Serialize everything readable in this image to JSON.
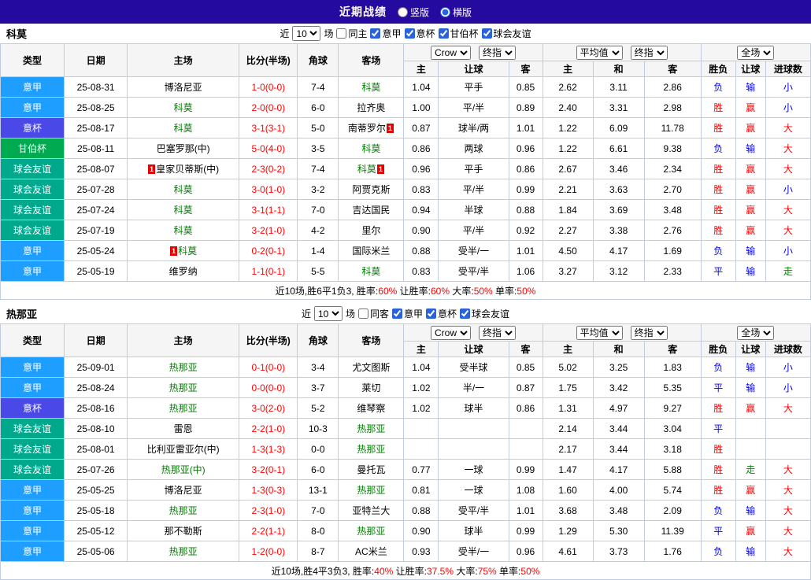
{
  "topbar": {
    "title": "近期战绩",
    "options": [
      {
        "label": "竖版",
        "checked": false
      },
      {
        "label": "横版",
        "checked": true
      }
    ]
  },
  "filter_labels": {
    "near": "近",
    "matches": "场"
  },
  "table_header": {
    "main_cols": [
      "类型",
      "日期",
      "主场",
      "比分(半场)",
      "角球",
      "客场"
    ],
    "odds_selects": [
      "Crow",
      "终指"
    ],
    "avg_selects": [
      "平均值",
      "终指"
    ],
    "scope_select": "全场",
    "sub_cols": [
      "主",
      "让球",
      "客",
      "主",
      "和",
      "客",
      "胜负",
      "让球",
      "进球数"
    ]
  },
  "colors": {
    "league": {
      "意甲": "#1e9fff",
      "意杯": "#4a49e8",
      "甘伯杯": "#00aa50",
      "球会友谊": "#00a88c"
    },
    "result": {
      "胜": "#ff0000",
      "平": "#0000ee",
      "负": "#0000ee",
      "赢": "#ff0000",
      "输": "#0000ee",
      "走": "#008800",
      "大": "#ff0000",
      "小": "#0000ee"
    },
    "score": "#ff0000",
    "team_highlight": "#008000",
    "badge": "#e60000"
  },
  "sections": [
    {
      "team": "科莫",
      "filter": {
        "count": "10",
        "checkboxes": [
          {
            "label": "同主",
            "checked": false
          },
          {
            "label": "意甲",
            "checked": true
          },
          {
            "label": "意杯",
            "checked": true
          },
          {
            "label": "甘伯杯",
            "checked": true
          },
          {
            "label": "球会友谊",
            "checked": true
          }
        ]
      },
      "rows": [
        {
          "league": "意甲",
          "date": "25-08-31",
          "home": {
            "text": "博洛尼亚"
          },
          "score": "1-0(0-0)",
          "corner": "7-4",
          "away": {
            "text": "科莫",
            "hl": true
          },
          "odds": [
            "1.04",
            "平手",
            "0.85"
          ],
          "avg": [
            "2.62",
            "3.11",
            "2.86"
          ],
          "results": [
            "负",
            "输",
            "小"
          ]
        },
        {
          "league": "意甲",
          "date": "25-08-25",
          "home": {
            "text": "科莫",
            "hl": true
          },
          "score": "2-0(0-0)",
          "corner": "6-0",
          "away": {
            "text": "拉齐奥"
          },
          "odds": [
            "1.00",
            "平/半",
            "0.89"
          ],
          "avg": [
            "2.40",
            "3.31",
            "2.98"
          ],
          "results": [
            "胜",
            "赢",
            "小"
          ]
        },
        {
          "league": "意杯",
          "date": "25-08-17",
          "home": {
            "text": "科莫",
            "hl": true
          },
          "score": "3-1(3-1)",
          "corner": "5-0",
          "away": {
            "text": "南蒂罗尔",
            "badge_after": "1"
          },
          "odds": [
            "0.87",
            "球半/两",
            "1.01"
          ],
          "avg": [
            "1.22",
            "6.09",
            "11.78"
          ],
          "results": [
            "胜",
            "赢",
            "大"
          ]
        },
        {
          "league": "甘伯杯",
          "date": "25-08-11",
          "home": {
            "text": "巴塞罗那(中)"
          },
          "score": "5-0(4-0)",
          "corner": "3-5",
          "away": {
            "text": "科莫",
            "hl": true
          },
          "odds": [
            "0.86",
            "两球",
            "0.96"
          ],
          "avg": [
            "1.22",
            "6.61",
            "9.38"
          ],
          "results": [
            "负",
            "输",
            "大"
          ]
        },
        {
          "league": "球会友谊",
          "date": "25-08-07",
          "home": {
            "text": "皇家贝蒂斯(中)",
            "badge_before": "1"
          },
          "score": "2-3(0-2)",
          "corner": "7-4",
          "away": {
            "text": "科莫",
            "hl": true,
            "badge_after": "1"
          },
          "odds": [
            "0.96",
            "平手",
            "0.86"
          ],
          "avg": [
            "2.67",
            "3.46",
            "2.34"
          ],
          "results": [
            "胜",
            "赢",
            "大"
          ]
        },
        {
          "league": "球会友谊",
          "date": "25-07-28",
          "home": {
            "text": "科莫",
            "hl": true
          },
          "score": "3-0(1-0)",
          "corner": "3-2",
          "away": {
            "text": "阿贾克斯"
          },
          "odds": [
            "0.83",
            "平/半",
            "0.99"
          ],
          "avg": [
            "2.21",
            "3.63",
            "2.70"
          ],
          "results": [
            "胜",
            "赢",
            "小"
          ]
        },
        {
          "league": "球会友谊",
          "date": "25-07-24",
          "home": {
            "text": "科莫",
            "hl": true
          },
          "score": "3-1(1-1)",
          "corner": "7-0",
          "away": {
            "text": "吉达国民"
          },
          "odds": [
            "0.94",
            "半球",
            "0.88"
          ],
          "avg": [
            "1.84",
            "3.69",
            "3.48"
          ],
          "results": [
            "胜",
            "赢",
            "大"
          ]
        },
        {
          "league": "球会友谊",
          "date": "25-07-19",
          "home": {
            "text": "科莫",
            "hl": true
          },
          "score": "3-2(1-0)",
          "corner": "4-2",
          "away": {
            "text": "里尔"
          },
          "odds": [
            "0.90",
            "平/半",
            "0.92"
          ],
          "avg": [
            "2.27",
            "3.38",
            "2.76"
          ],
          "results": [
            "胜",
            "赢",
            "大"
          ]
        },
        {
          "league": "意甲",
          "date": "25-05-24",
          "home": {
            "text": "科莫",
            "hl": true,
            "badge_before": "1"
          },
          "score": "0-2(0-1)",
          "corner": "1-4",
          "away": {
            "text": "国际米兰"
          },
          "odds": [
            "0.88",
            "受半/一",
            "1.01"
          ],
          "avg": [
            "4.50",
            "4.17",
            "1.69"
          ],
          "results": [
            "负",
            "输",
            "小"
          ]
        },
        {
          "league": "意甲",
          "date": "25-05-19",
          "home": {
            "text": "维罗纳"
          },
          "score": "1-1(0-1)",
          "corner": "5-5",
          "away": {
            "text": "科莫",
            "hl": true
          },
          "odds": [
            "0.83",
            "受平/半",
            "1.06"
          ],
          "avg": [
            "3.27",
            "3.12",
            "2.33"
          ],
          "results": [
            "平",
            "输",
            "走"
          ]
        }
      ],
      "summary": [
        {
          "t": "近10场,胜6平1负3, 胜率:"
        },
        {
          "t": "60%",
          "red": true
        },
        {
          "t": " 让胜率:"
        },
        {
          "t": "60%",
          "red": true
        },
        {
          "t": " 大率:"
        },
        {
          "t": "50%",
          "red": true
        },
        {
          "t": " 单率:"
        },
        {
          "t": "50%",
          "red": true
        }
      ]
    },
    {
      "team": "热那亚",
      "filter": {
        "count": "10",
        "checkboxes": [
          {
            "label": "同客",
            "checked": false
          },
          {
            "label": "意甲",
            "checked": true
          },
          {
            "label": "意杯",
            "checked": true
          },
          {
            "label": "球会友谊",
            "checked": true
          }
        ]
      },
      "rows": [
        {
          "league": "意甲",
          "date": "25-09-01",
          "home": {
            "text": "热那亚",
            "hl": true
          },
          "score": "0-1(0-0)",
          "corner": "3-4",
          "away": {
            "text": "尤文图斯"
          },
          "odds": [
            "1.04",
            "受半球",
            "0.85"
          ],
          "avg": [
            "5.02",
            "3.25",
            "1.83"
          ],
          "results": [
            "负",
            "输",
            "小"
          ]
        },
        {
          "league": "意甲",
          "date": "25-08-24",
          "home": {
            "text": "热那亚",
            "hl": true
          },
          "score": "0-0(0-0)",
          "corner": "3-7",
          "away": {
            "text": "莱切"
          },
          "odds": [
            "1.02",
            "半/一",
            "0.87"
          ],
          "avg": [
            "1.75",
            "3.42",
            "5.35"
          ],
          "results": [
            "平",
            "输",
            "小"
          ]
        },
        {
          "league": "意杯",
          "date": "25-08-16",
          "home": {
            "text": "热那亚",
            "hl": true
          },
          "score": "3-0(2-0)",
          "corner": "5-2",
          "away": {
            "text": "维琴察"
          },
          "odds": [
            "1.02",
            "球半",
            "0.86"
          ],
          "avg": [
            "1.31",
            "4.97",
            "9.27"
          ],
          "results": [
            "胜",
            "赢",
            "大"
          ]
        },
        {
          "league": "球会友谊",
          "date": "25-08-10",
          "home": {
            "text": "雷恩"
          },
          "score": "2-2(1-0)",
          "corner": "10-3",
          "away": {
            "text": "热那亚",
            "hl": true
          },
          "odds": [
            "",
            "",
            ""
          ],
          "avg": [
            "2.14",
            "3.44",
            "3.04"
          ],
          "results": [
            "平",
            "",
            ""
          ]
        },
        {
          "league": "球会友谊",
          "date": "25-08-01",
          "home": {
            "text": "比利亚雷亚尔(中)"
          },
          "score": "1-3(1-3)",
          "corner": "0-0",
          "away": {
            "text": "热那亚",
            "hl": true
          },
          "odds": [
            "",
            "",
            ""
          ],
          "avg": [
            "2.17",
            "3.44",
            "3.18"
          ],
          "results": [
            "胜",
            "",
            ""
          ]
        },
        {
          "league": "球会友谊",
          "date": "25-07-26",
          "home": {
            "text": "热那亚(中)",
            "hl": true
          },
          "score": "3-2(0-1)",
          "corner": "6-0",
          "away": {
            "text": "曼托瓦"
          },
          "odds": [
            "0.77",
            "一球",
            "0.99"
          ],
          "avg": [
            "1.47",
            "4.17",
            "5.88"
          ],
          "results": [
            "胜",
            "走",
            "大"
          ]
        },
        {
          "league": "意甲",
          "date": "25-05-25",
          "home": {
            "text": "博洛尼亚"
          },
          "score": "1-3(0-3)",
          "corner": "13-1",
          "away": {
            "text": "热那亚",
            "hl": true
          },
          "odds": [
            "0.81",
            "一球",
            "1.08"
          ],
          "avg": [
            "1.60",
            "4.00",
            "5.74"
          ],
          "results": [
            "胜",
            "赢",
            "大"
          ]
        },
        {
          "league": "意甲",
          "date": "25-05-18",
          "home": {
            "text": "热那亚",
            "hl": true
          },
          "score": "2-3(1-0)",
          "corner": "7-0",
          "away": {
            "text": "亚特兰大"
          },
          "odds": [
            "0.88",
            "受平/半",
            "1.01"
          ],
          "avg": [
            "3.68",
            "3.48",
            "2.09"
          ],
          "results": [
            "负",
            "输",
            "大"
          ]
        },
        {
          "league": "意甲",
          "date": "25-05-12",
          "home": {
            "text": "那不勒斯"
          },
          "score": "2-2(1-1)",
          "corner": "8-0",
          "away": {
            "text": "热那亚",
            "hl": true
          },
          "odds": [
            "0.90",
            "球半",
            "0.99"
          ],
          "avg": [
            "1.29",
            "5.30",
            "11.39"
          ],
          "results": [
            "平",
            "赢",
            "大"
          ]
        },
        {
          "league": "意甲",
          "date": "25-05-06",
          "home": {
            "text": "热那亚",
            "hl": true
          },
          "score": "1-2(0-0)",
          "corner": "8-7",
          "away": {
            "text": "AC米兰"
          },
          "odds": [
            "0.93",
            "受半/一",
            "0.96"
          ],
          "avg": [
            "4.61",
            "3.73",
            "1.76"
          ],
          "results": [
            "负",
            "输",
            "大"
          ]
        }
      ],
      "summary": [
        {
          "t": "近10场,胜4平3负3, 胜率:"
        },
        {
          "t": "40%",
          "red": true
        },
        {
          "t": " 让胜率:"
        },
        {
          "t": "37.5%",
          "red": true
        },
        {
          "t": " 大率:"
        },
        {
          "t": "75%",
          "red": true
        },
        {
          "t": " 单率:"
        },
        {
          "t": "50%",
          "red": true
        }
      ]
    }
  ]
}
